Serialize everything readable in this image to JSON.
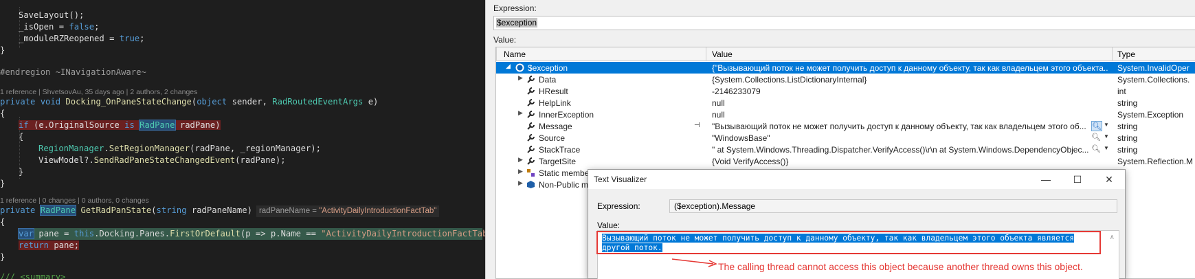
{
  "editor": {
    "lines": {
      "l1": "SaveLayout();",
      "l2a": "_isOpen",
      "l2b": " = ",
      "l2c": "false",
      "l2d": ";",
      "l3a": "_moduleRZReopened",
      "l3b": " = ",
      "l3c": "true",
      "l3d": ";",
      "l4": "}",
      "l6": "#endregion ~INavigationAware~",
      "lens1": "1 reference | ShvetsovAu, 35 days ago | 2 authors, 2 changes",
      "l8_private": "private",
      "l8_void": "void",
      "l8_name": "Docking_OnPaneStateChange",
      "l8_p1": "(",
      "l8_object": "object",
      "l8_p2": " sender, ",
      "l8_type": "RadRoutedEventArgs",
      "l8_p3": " e)",
      "l9": "{",
      "l10_if": "if",
      "l10_mid": " (e.OriginalSource ",
      "l10_is": "is",
      "l10_type": "RadPane",
      "l10_end": " radPane)",
      "l11": "{",
      "l12_type": "RegionManager",
      "l12_dot": ".",
      "l12_fn": "SetRegionManager",
      "l12_end": "(radPane, _regionManager);",
      "l13_a": "ViewModel?.",
      "l13_fn": "SendRadPaneStateChangedEvent",
      "l13_end": "(radPane);",
      "l14": "}",
      "l15": "}",
      "lens2": "1 reference | 0 changes | 0 authors, 0 changes",
      "l17_private": "private",
      "l17_type": "RadPane",
      "l17_fn": "GetRadPanState",
      "l17_p1": "(",
      "l17_string": "string",
      "l17_end": " radPaneName)",
      "hint_name": "radPaneName = ",
      "hint_value": "\"ActivityDailyIntroductionFactTab\"",
      "l18": "{",
      "l19_var": "var",
      "l19_a": " pane = ",
      "l19_this": "this",
      "l19_b": ".Docking.Panes.",
      "l19_fn": "FirstOrDefault",
      "l19_c": "(p => p.Name == ",
      "l19_str": "\"ActivityDailyIntroductionFactTab\"",
      "l19_d": ");",
      "l20_ret": "return",
      "l20_end": " pane;",
      "l21": "}",
      "l23": "/// <summary>"
    }
  },
  "quickwatch": {
    "expression_label": "Expression:",
    "expression_value": "$exception",
    "value_label": "Value:",
    "columns": {
      "name": "Name",
      "value": "Value",
      "type": "Type"
    },
    "rows": [
      {
        "name": "$exception",
        "value": "{\"Вызывающий поток не может получить доступ к данному объекту, так как владельцем этого объекта...",
        "type": "System.InvalidOper"
      },
      {
        "name": "Data",
        "value": "{System.Collections.ListDictionaryInternal}",
        "type": "System.Collections."
      },
      {
        "name": "HResult",
        "value": "-2146233079",
        "type": "int"
      },
      {
        "name": "HelpLink",
        "value": "null",
        "type": "string"
      },
      {
        "name": "InnerException",
        "value": "null",
        "type": "System.Exception"
      },
      {
        "name": "Message",
        "value": "\"Вызывающий поток не может получить доступ к данному объекту, так как владельцем этого об...",
        "type": "string"
      },
      {
        "name": "Source",
        "value": "\"WindowsBase\"",
        "type": "string"
      },
      {
        "name": "StackTrace",
        "value": "\"   at System.Windows.Threading.Dispatcher.VerifyAccess()\\r\\n   at System.Windows.DependencyObjec...",
        "type": "string"
      },
      {
        "name": "TargetSite",
        "value": "{Void VerifyAccess()}",
        "type": "System.Reflection.M"
      },
      {
        "name": "Static members",
        "value": "",
        "type": ""
      },
      {
        "name": "Non-Public mem",
        "value": "",
        "type": ""
      }
    ]
  },
  "text_visualizer": {
    "title": "Text Visualizer",
    "expression_label": "Expression:",
    "expression_value": "($exception).Message",
    "value_label": "Value:",
    "value_text": "Вызывающий поток не может получить доступ к данному объекту, так как владельцем этого объекта является другой поток."
  },
  "annotation": "The calling thread cannot access this object because another thread owns this object.",
  "colors": {
    "selection": "#0078d7",
    "annotation_red": "#e53935",
    "breakpoint_bg": "#6b2020",
    "statement_bg": "#35594a"
  }
}
